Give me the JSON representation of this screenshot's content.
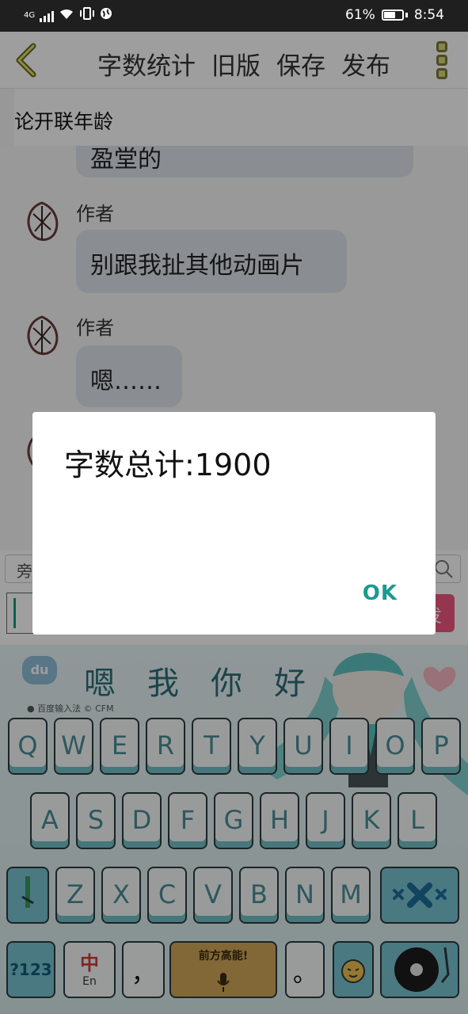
{
  "status_bar": {
    "network": "4G",
    "battery_percent": "61%",
    "time": "8:54"
  },
  "header": {
    "actions": [
      "字数统计",
      "旧版",
      "保存",
      "发布"
    ]
  },
  "page_title": "论开联年龄",
  "chat": {
    "messages": [
      {
        "author": "",
        "text": "盈堂的"
      },
      {
        "author": "作者",
        "text": "别跟我扯其他动画片"
      },
      {
        "author": "作者",
        "text": "嗯……"
      }
    ]
  },
  "input_bar": {
    "search_placeholder": "旁",
    "send_label": "发"
  },
  "keyboard": {
    "brand": "du",
    "brand_text": "● 百度输入法 © CFM",
    "candidates": [
      "嗯",
      "我",
      "你",
      "好"
    ],
    "row1": [
      "Q",
      "W",
      "E",
      "R",
      "T",
      "Y",
      "U",
      "I",
      "O",
      "P"
    ],
    "row2": [
      "A",
      "S",
      "D",
      "F",
      "G",
      "H",
      "J",
      "K",
      "L"
    ],
    "row3": [
      "Z",
      "X",
      "C",
      "V",
      "B",
      "N",
      "M"
    ],
    "row4": {
      "symbols": "?123",
      "lang": "中",
      "lang_sub": "En",
      "comma": "，",
      "space_label": "前方高能!",
      "period": "。"
    }
  },
  "dialog": {
    "message": "字数总计:1900",
    "ok_label": "OK"
  }
}
